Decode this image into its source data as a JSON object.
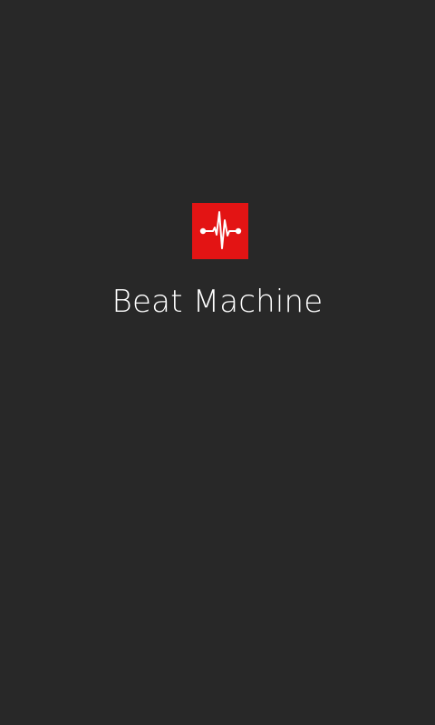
{
  "app": {
    "title": "Beat Machine",
    "logo_icon": "heartbeat-waveform-icon"
  },
  "colors": {
    "background": "#282828",
    "accent": "#e31414",
    "text": "#ffffff"
  }
}
